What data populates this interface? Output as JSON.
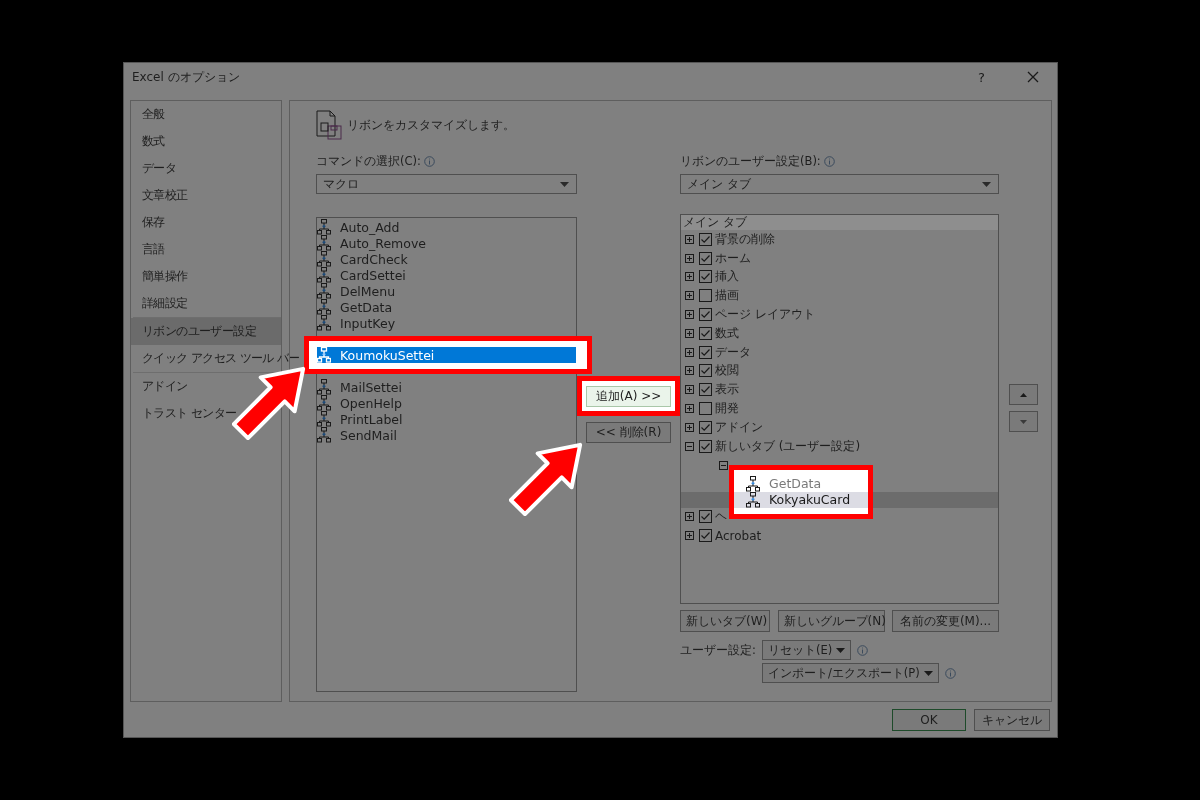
{
  "window": {
    "title": "Excel のオプション",
    "help": "?"
  },
  "sidebar": {
    "items": [
      {
        "label": "全般",
        "selected": false,
        "divider_before": false
      },
      {
        "label": "数式",
        "selected": false,
        "divider_before": false
      },
      {
        "label": "データ",
        "selected": false,
        "divider_before": false
      },
      {
        "label": "文章校正",
        "selected": false,
        "divider_before": false
      },
      {
        "label": "保存",
        "selected": false,
        "divider_before": false
      },
      {
        "label": "言語",
        "selected": false,
        "divider_before": false
      },
      {
        "label": "簡単操作",
        "selected": false,
        "divider_before": false
      },
      {
        "label": "詳細設定",
        "selected": false,
        "divider_before": false
      },
      {
        "label": "リボンのユーザー設定",
        "selected": true,
        "divider_before": true
      },
      {
        "label": "クイック アクセス ツール バー",
        "selected": false,
        "divider_before": false
      },
      {
        "label": "アドイン",
        "selected": false,
        "divider_before": true
      },
      {
        "label": "トラスト センター",
        "selected": false,
        "divider_before": false
      }
    ]
  },
  "heading": "リボンをカスタマイズします。",
  "commands": {
    "label": "コマンドの選択(C):",
    "dropdown": "マクロ",
    "items": [
      {
        "label": "Auto_Add",
        "selected": false
      },
      {
        "label": "Auto_Remove",
        "selected": false
      },
      {
        "label": "CardCheck",
        "selected": false
      },
      {
        "label": "CardSettei",
        "selected": false
      },
      {
        "label": "DelMenu",
        "selected": false
      },
      {
        "label": "GetData",
        "selected": false
      },
      {
        "label": "InputKey",
        "selected": false
      },
      {
        "selected": false
      },
      {
        "label": "KoumokuSettei",
        "selected": true,
        "highlighted": true
      },
      {
        "selected": false
      },
      {
        "label": "MailSettei",
        "selected": false
      },
      {
        "label": "OpenHelp",
        "selected": false
      },
      {
        "label": "PrintLabel",
        "selected": false
      },
      {
        "label": "SendMail",
        "selected": false
      }
    ]
  },
  "add_button": {
    "label": "追加(A) >>",
    "highlighted": true
  },
  "remove_button": {
    "label": "<< 削除(R)"
  },
  "ribbon": {
    "label": "リボンのユーザー設定(B):",
    "dropdown": "メイン タブ",
    "tree_header": "メイン タブ",
    "tree": [
      {
        "label": "背景の削除",
        "checked": true,
        "expanded": false
      },
      {
        "label": "ホーム",
        "checked": true,
        "expanded": false
      },
      {
        "label": "挿入",
        "checked": true,
        "expanded": false
      },
      {
        "label": "描画",
        "checked": false,
        "expanded": false
      },
      {
        "label": "ページ レイアウト",
        "checked": true,
        "expanded": false
      },
      {
        "label": "数式",
        "checked": true,
        "expanded": false
      },
      {
        "label": "データ",
        "checked": true,
        "expanded": false
      },
      {
        "label": "校閲",
        "checked": true,
        "expanded": false
      },
      {
        "label": "表示",
        "checked": true,
        "expanded": false
      },
      {
        "label": "開発",
        "checked": false,
        "expanded": false
      },
      {
        "label": "アドイン",
        "checked": true,
        "expanded": false
      },
      {
        "label": "新しいタブ (ユーザー設定)",
        "checked": true,
        "expanded": true,
        "children": [
          {
            "expanded": true,
            "children_highlighted": true,
            "children": [
              {
                "label": "GetData",
                "selected": false
              },
              {
                "label": "KokyakuCard",
                "selected": true
              }
            ]
          }
        ]
      },
      {
        "label": "ヘ",
        "checked": true,
        "expanded": false
      },
      {
        "label": "Acrobat",
        "checked": true,
        "expanded": false
      }
    ]
  },
  "tree_buttons": [
    "新しいタブ(W)",
    "新しいグループ(N)",
    "名前の変更(M)..."
  ],
  "customize_label": "ユーザー設定:",
  "reset": "リセット(E)",
  "import_export": "インポート/エクスポート(P)",
  "ok": "OK",
  "cancel": "キャンセル"
}
